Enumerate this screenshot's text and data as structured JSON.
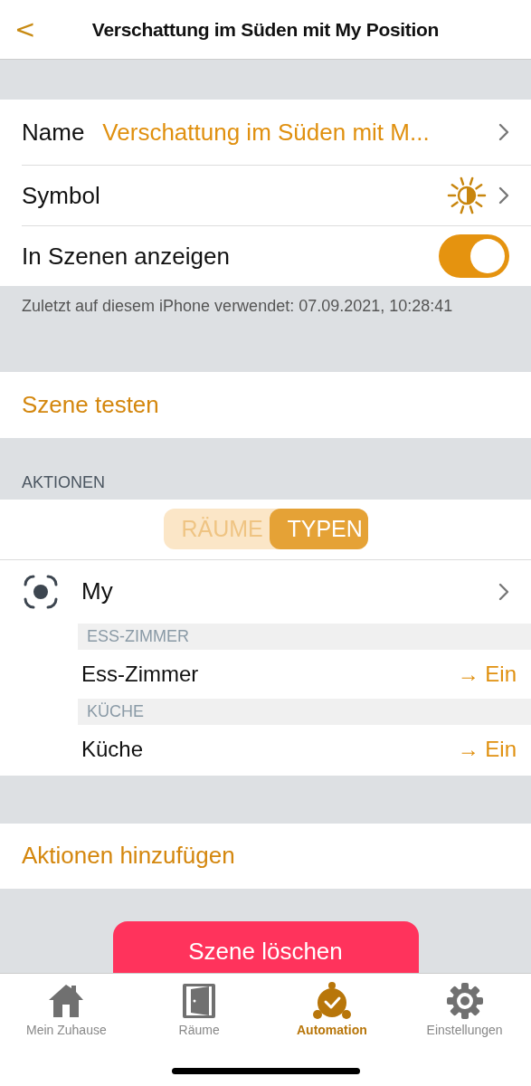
{
  "nav": {
    "back": "<",
    "title": "Verschattung im Süden mit My Position"
  },
  "settings": [
    {
      "kind": "value",
      "label": "Name",
      "value": "Verschattung im Süden mit M..."
    },
    {
      "kind": "icon",
      "label": "Symbol"
    },
    {
      "kind": "toggle",
      "label": "In Szenen anzeigen",
      "on": true
    }
  ],
  "note": "Zuletzt auf diesem iPhone verwendet: 07.09.2021, 10:28:41",
  "test_button": "Szene testen",
  "actions": {
    "header": "AKTIONEN",
    "segments": [
      {
        "label": "RÄUME",
        "selected": false
      },
      {
        "label": "TYPEN",
        "selected": true
      }
    ],
    "groups": [
      {
        "title": "My",
        "rooms": [
          {
            "header": "ESS-ZIMMER",
            "device": "Ess-Zimmer",
            "value": "→ Ein"
          },
          {
            "header": "KÜCHE",
            "device": "Küche",
            "value": "→ Ein"
          }
        ]
      }
    ]
  },
  "add_button": "Aktionen hinzufügen",
  "delete_button": "Szene löschen",
  "tabs": [
    {
      "kind": "home",
      "label": "Mein Zuhause",
      "selected": false
    },
    {
      "kind": "door",
      "label": "Räume",
      "selected": false
    },
    {
      "kind": "clock",
      "label": "Automation",
      "selected": true
    },
    {
      "kind": "gear",
      "label": "Einstellungen",
      "selected": false
    }
  ]
}
